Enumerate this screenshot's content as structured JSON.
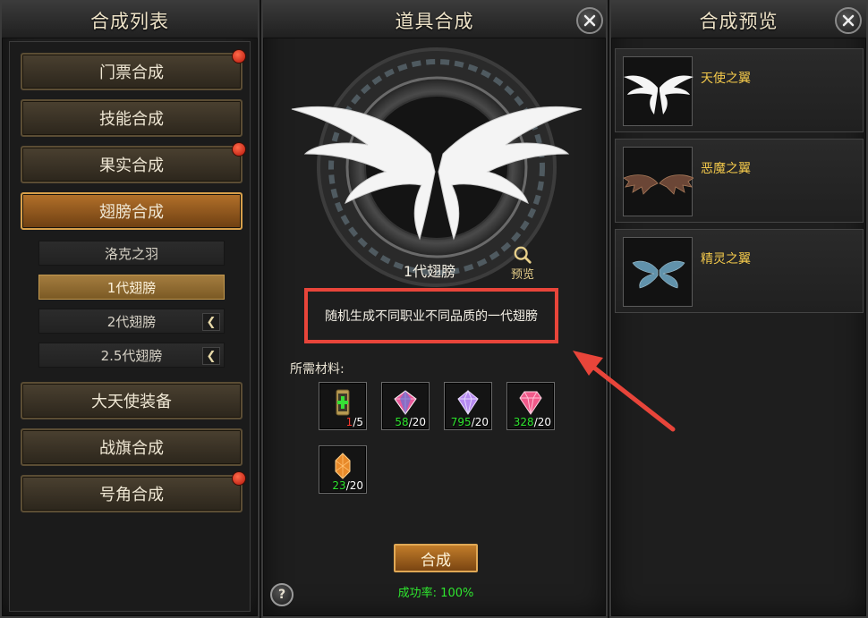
{
  "left_panel": {
    "title": "合成列表",
    "categories": [
      {
        "label": "门票合成",
        "badge": true
      },
      {
        "label": "技能合成",
        "badge": false
      },
      {
        "label": "果实合成",
        "badge": true
      },
      {
        "label": "翅膀合成",
        "badge": false,
        "active": true
      },
      {
        "label": "大天使装备",
        "badge": false
      },
      {
        "label": "战旗合成",
        "badge": false
      },
      {
        "label": "号角合成",
        "badge": true
      }
    ],
    "subitems": [
      {
        "label": "洛克之羽",
        "active": false,
        "expandable": false
      },
      {
        "label": "1代翅膀",
        "active": true,
        "expandable": false
      },
      {
        "label": "2代翅膀",
        "active": false,
        "expandable": true
      },
      {
        "label": "2.5代翅膀",
        "active": false,
        "expandable": true
      }
    ]
  },
  "middle_panel": {
    "title": "道具合成",
    "item_name": "1代翅膀",
    "preview_label": "预览",
    "description": "随机生成不同职业不同品质的一代翅膀",
    "materials_label": "所需材料:",
    "materials": [
      {
        "icon": "green-cross-scroll-icon",
        "have": "1",
        "need": "/5",
        "have_color": "red"
      },
      {
        "icon": "pink-gem-icon",
        "have": "58",
        "need": "/20",
        "have_color": "green"
      },
      {
        "icon": "purple-crystal-icon",
        "have": "795",
        "need": "/20",
        "have_color": "green"
      },
      {
        "icon": "ruby-diamond-icon",
        "have": "328",
        "need": "/20",
        "have_color": "green"
      },
      {
        "icon": "orange-crystal-icon",
        "have": "23",
        "need": "/20",
        "have_color": "green"
      }
    ],
    "craft_label": "合成",
    "success_rate": "成功率: 100%",
    "help_label": "?"
  },
  "right_panel": {
    "title": "合成预览",
    "previews": [
      {
        "name": "天使之翼",
        "icon": "angel-wings-icon"
      },
      {
        "name": "恶魔之翼",
        "icon": "demon-wings-icon"
      },
      {
        "name": "精灵之翼",
        "icon": "fairy-wings-icon"
      }
    ]
  },
  "colors": {
    "highlight_box": "#e8453a",
    "active_category": "#b3712a",
    "preview_name": "#f2c84b",
    "count_green": "#2ee62e",
    "count_red": "#ff3b30"
  }
}
